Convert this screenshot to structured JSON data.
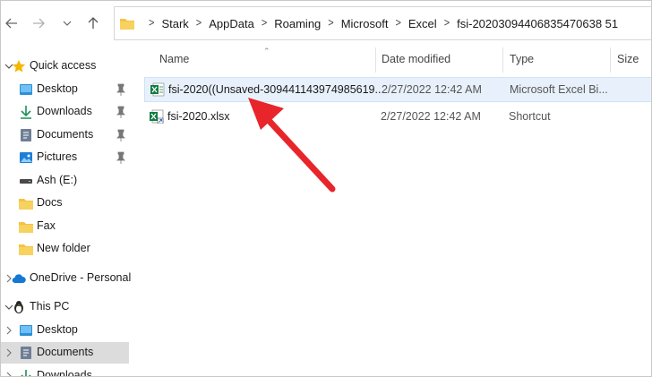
{
  "address_bar": {
    "path": [
      "Stark",
      "AppData",
      "Roaming",
      "Microsoft",
      "Excel",
      "fsi-20203094406835470638 51"
    ]
  },
  "sidebar": {
    "quick_access": "Quick access",
    "items": [
      {
        "label": "Desktop",
        "icon": "desktop-icon",
        "pinned": true
      },
      {
        "label": "Downloads",
        "icon": "download-icon",
        "pinned": true
      },
      {
        "label": "Documents",
        "icon": "documents-icon",
        "pinned": true
      },
      {
        "label": "Pictures",
        "icon": "pictures-icon",
        "pinned": true
      },
      {
        "label": "Ash (E:)",
        "icon": "drive-icon",
        "pinned": false
      },
      {
        "label": "Docs",
        "icon": "folder-icon",
        "pinned": false
      },
      {
        "label": "Fax",
        "icon": "folder-icon",
        "pinned": false
      },
      {
        "label": "New folder",
        "icon": "folder-icon",
        "pinned": false
      }
    ],
    "onedrive": "OneDrive - Personal",
    "this_pc": "This PC",
    "pc_items": [
      {
        "label": "Desktop"
      },
      {
        "label": "Documents"
      },
      {
        "label": "Downloads"
      }
    ]
  },
  "columns": {
    "name": "Name",
    "date": "Date modified",
    "type": "Type",
    "size": "Size"
  },
  "files": [
    {
      "name": "fsi-2020((Unsaved-309441143974985619...",
      "date": "2/27/2022 12:42 AM",
      "type": "Microsoft Excel Bi..."
    },
    {
      "name": "fsi-2020.xlsx",
      "date": "2/27/2022 12:42 AM",
      "type": "Shortcut"
    }
  ],
  "colors": {
    "selection": "#e8f1fb",
    "arrow": "#e8252b",
    "folder": "#f5c242"
  }
}
